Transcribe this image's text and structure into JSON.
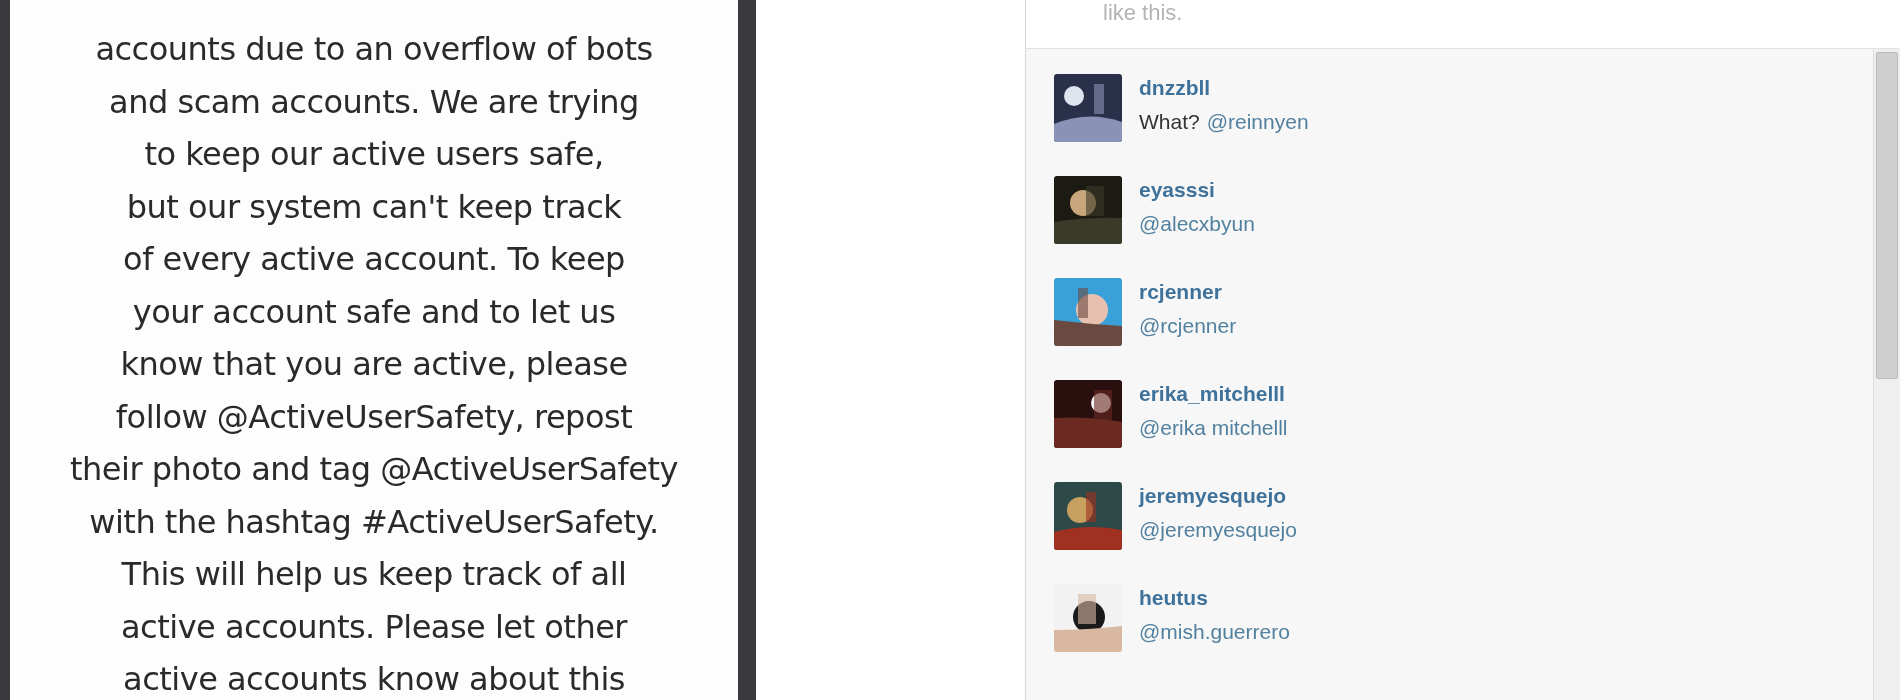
{
  "post": {
    "lines": [
      "accounts due to an overflow of bots",
      "and scam accounts. We are trying",
      "to keep our active users safe,",
      "but our system can't keep track",
      "of every active account. To keep",
      "your account safe and to let us",
      "know that you are active, please",
      "follow @ActiveUserSafety, repost",
      "their photo and tag @ActiveUserSafety",
      "with the hashtag #ActiveUserSafety.",
      "This will help us keep track of all",
      "active accounts. Please let other",
      "active accounts know about this"
    ]
  },
  "likes": {
    "text": "like this."
  },
  "comments": [
    {
      "username": "dnzzbll",
      "text": "What?",
      "mention": "@reinnyen"
    },
    {
      "username": "eyasssi",
      "mention": "@alecxbyun"
    },
    {
      "username": "rcjenner",
      "mention": "@rcjenner"
    },
    {
      "username": "erika_mitchelll",
      "mention": "@erika mitchelll"
    },
    {
      "username": "jeremyesquejo",
      "mention": "@jeremyesquejo"
    },
    {
      "username": "heutus",
      "mention": "@mish.guerrero"
    }
  ]
}
